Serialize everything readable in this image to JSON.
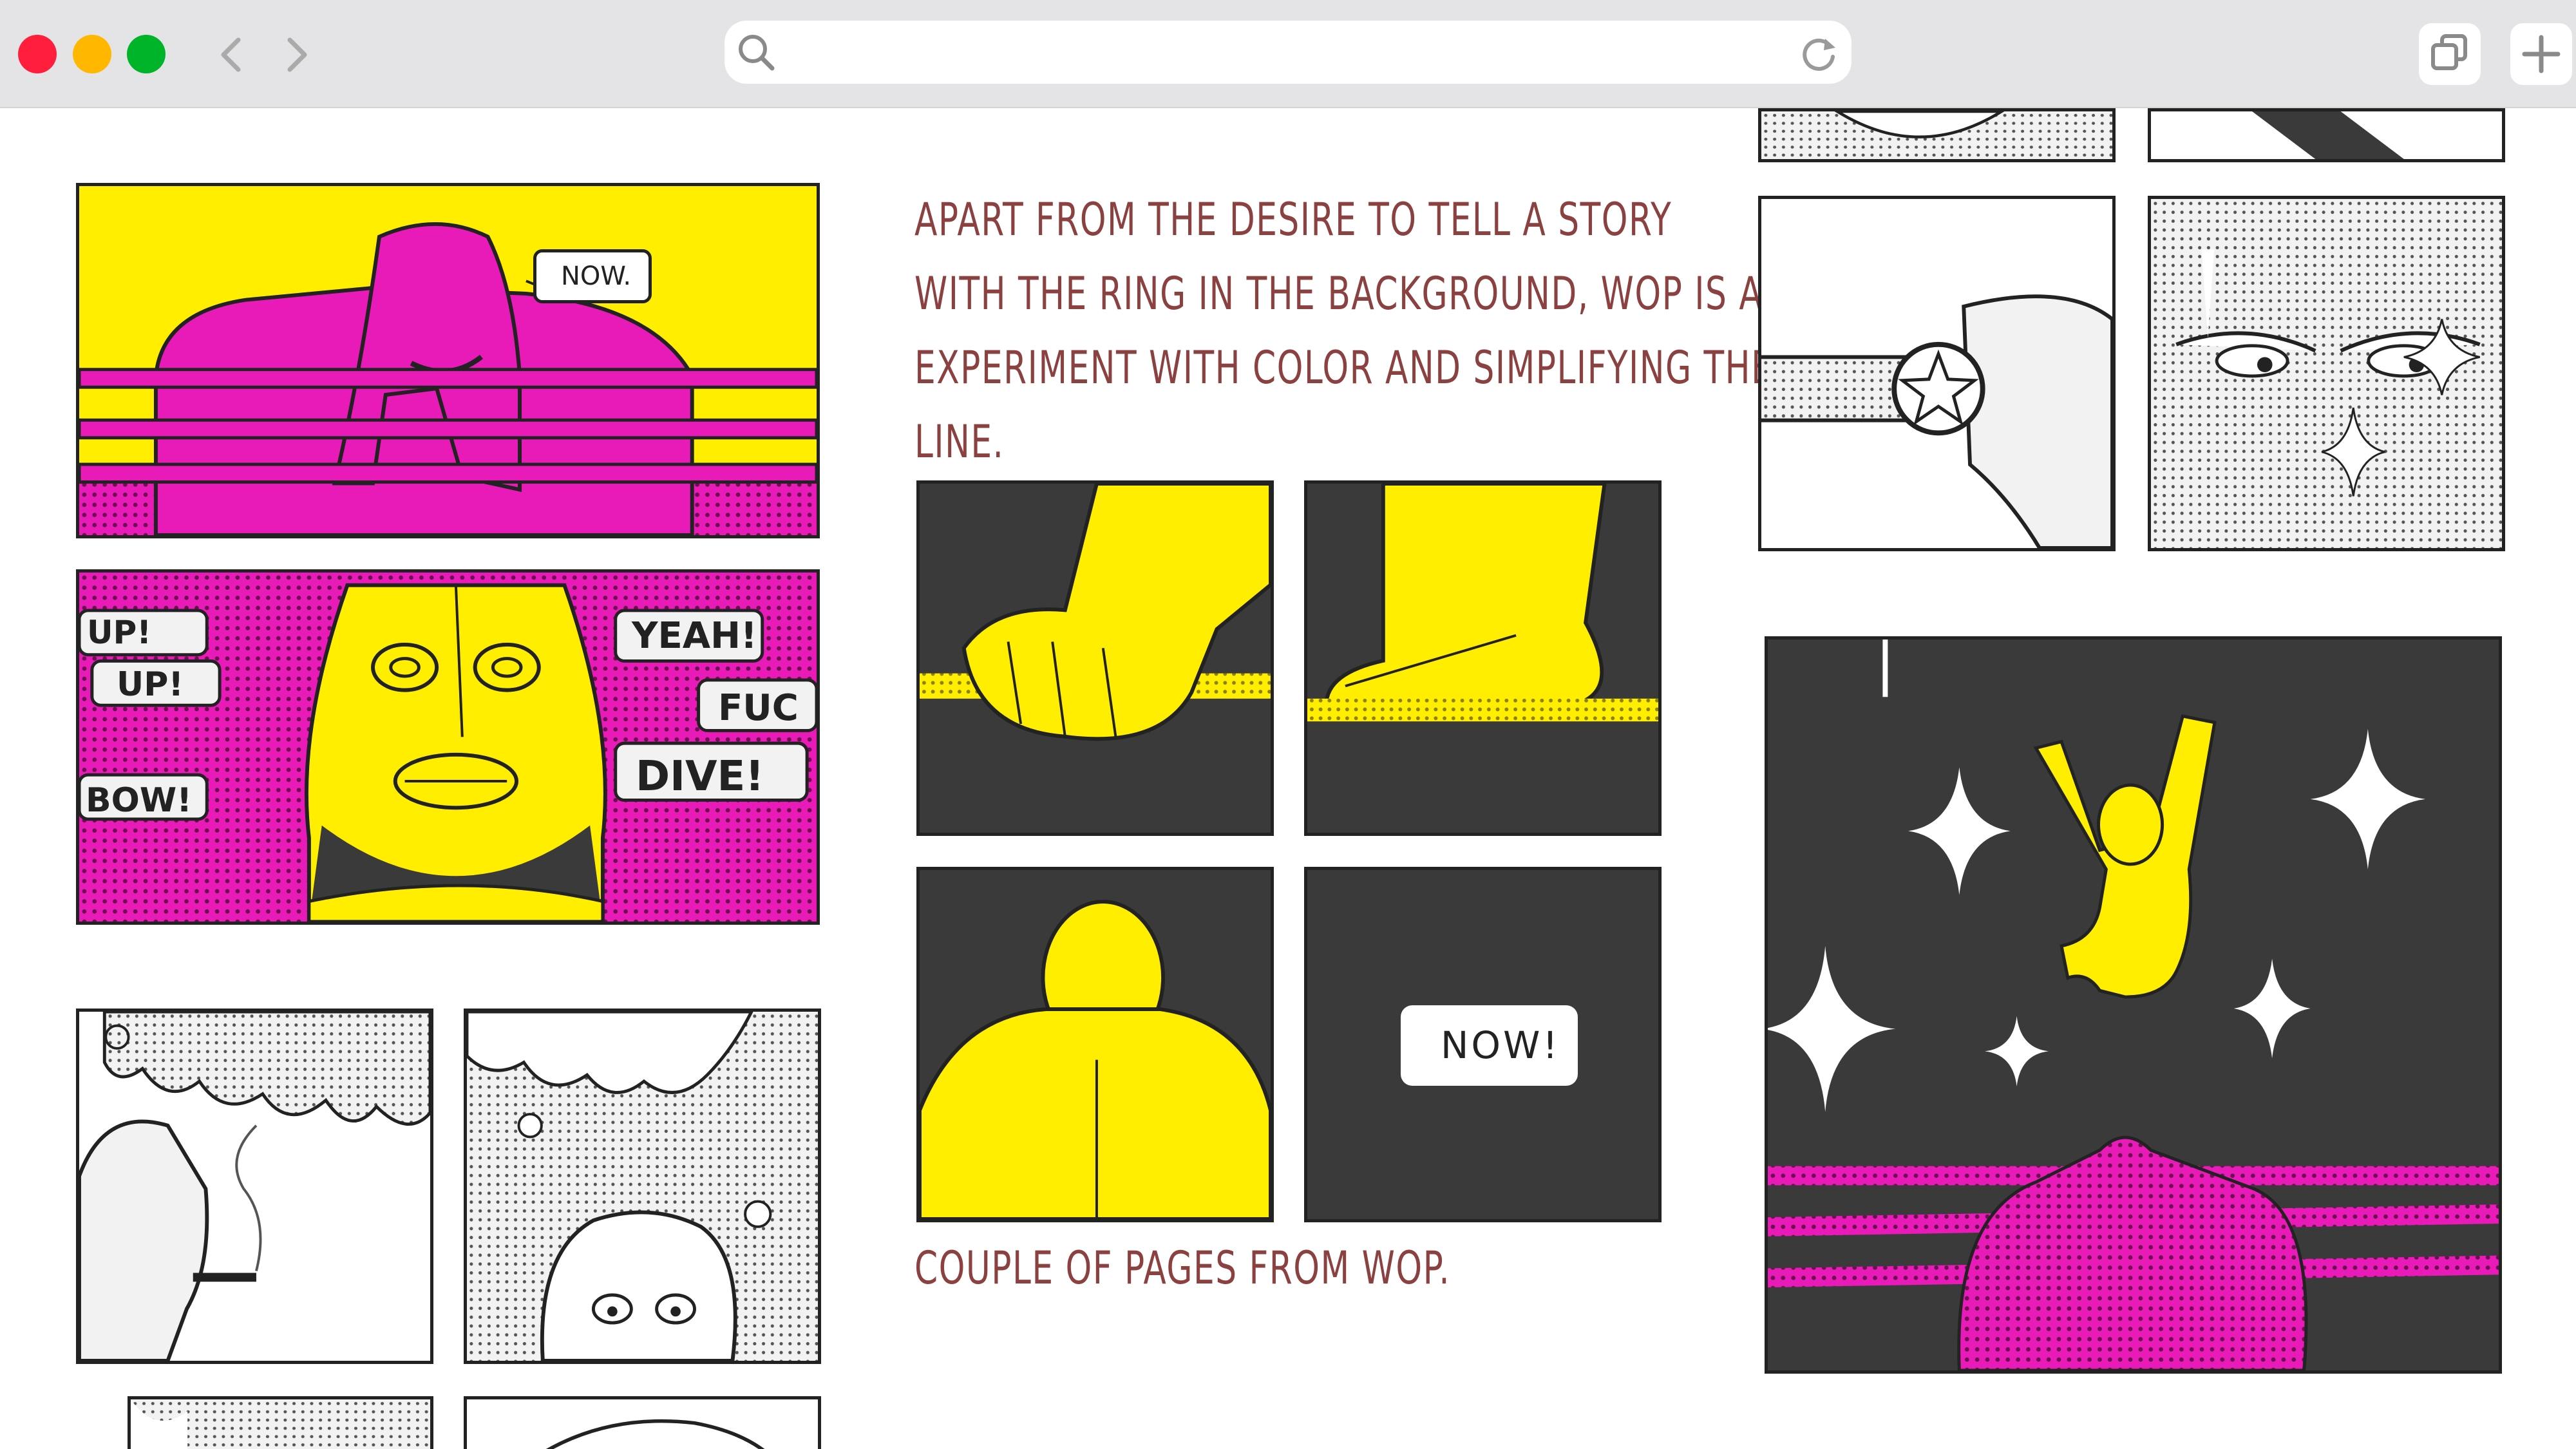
{
  "browser": {
    "address_value": "",
    "address_placeholder": "",
    "icons": [
      "close-dot",
      "minimize-dot",
      "maximize-dot",
      "back-arrow-icon",
      "forward-arrow-icon",
      "search-icon",
      "reload-icon",
      "tabs-icon",
      "new-tab-icon"
    ],
    "colors": {
      "close": "#ff1f3d",
      "minimize": "#ffb700",
      "maximize": "#00b429",
      "chrome": "#e4e4e6"
    }
  },
  "article": {
    "description_lines": [
      "APART FROM THE DESIRE TO TELL A STORY",
      "WITH THE RING IN THE BACKGROUND, WOP IS AN",
      "EXPERIMENT WITH COLOR AND SIMPLIFYING THE",
      "LINE."
    ],
    "caption": "COUPLE OF PAGES FROM WOP.",
    "text_color": "#8c4141"
  },
  "comics": {
    "bubble_now_small": "NOW.",
    "bubble_now_large": "NOW!",
    "sfx_left": [
      "UP!",
      "UP!",
      "!",
      "BOW!"
    ],
    "sfx_right": [
      "YEAH!",
      "FUC",
      "DIVE!"
    ],
    "colors": {
      "yellow": "#ffee00",
      "magenta": "#e81ab8",
      "dark": "#3a3a3a",
      "ink": "#222222",
      "paper": "#f2f2f2"
    }
  }
}
